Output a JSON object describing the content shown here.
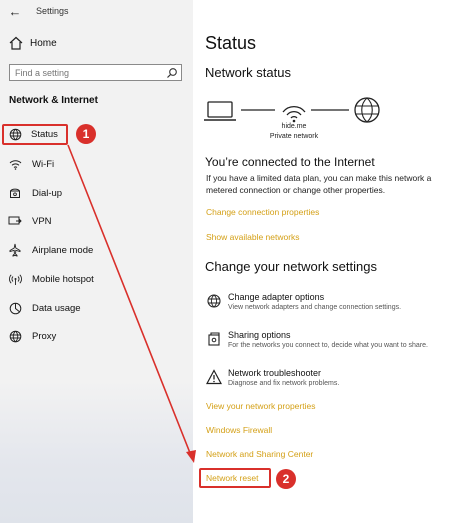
{
  "window": {
    "title": "Settings",
    "back_icon": "back-arrow-icon"
  },
  "sidebar": {
    "home_label": "Home",
    "search_placeholder": "Find a setting",
    "section_title": "Network & Internet",
    "items": [
      {
        "label": "Status",
        "icon": "status-globe-icon"
      },
      {
        "label": "Wi-Fi",
        "icon": "wifi-icon"
      },
      {
        "label": "Dial-up",
        "icon": "dialup-icon"
      },
      {
        "label": "VPN",
        "icon": "vpn-icon"
      },
      {
        "label": "Airplane mode",
        "icon": "airplane-icon"
      },
      {
        "label": "Mobile hotspot",
        "icon": "hotspot-icon"
      },
      {
        "label": "Data usage",
        "icon": "data-usage-icon"
      },
      {
        "label": "Proxy",
        "icon": "proxy-globe-icon"
      }
    ]
  },
  "main": {
    "title": "Status",
    "network_status_heading": "Network status",
    "network_name": "hide.me",
    "network_type": "Private network",
    "connected_heading": "You’re connected to the Internet",
    "connected_text": "If you have a limited data plan, you can make this network a metered connection or change other properties.",
    "links_top": [
      "Change connection properties",
      "Show available networks"
    ],
    "change_heading": "Change your network settings",
    "options": [
      {
        "title": "Change adapter options",
        "desc": "View network adapters and change connection settings.",
        "icon": "adapter-globe-icon"
      },
      {
        "title": "Sharing options",
        "desc": "For the networks you connect to, decide what you want to share.",
        "icon": "sharing-icon"
      },
      {
        "title": "Network troubleshooter",
        "desc": "Diagnose and fix network problems.",
        "icon": "warning-triangle-icon"
      }
    ],
    "links_bottom": [
      "View your network properties",
      "Windows Firewall",
      "Network and Sharing Center",
      "Network reset"
    ]
  },
  "annotations": {
    "step1": "1",
    "step2": "2"
  },
  "colors": {
    "accent_link": "#d4a017",
    "annotation_red": "#d9302b",
    "sidebar_bg": "#f2f2f2"
  }
}
